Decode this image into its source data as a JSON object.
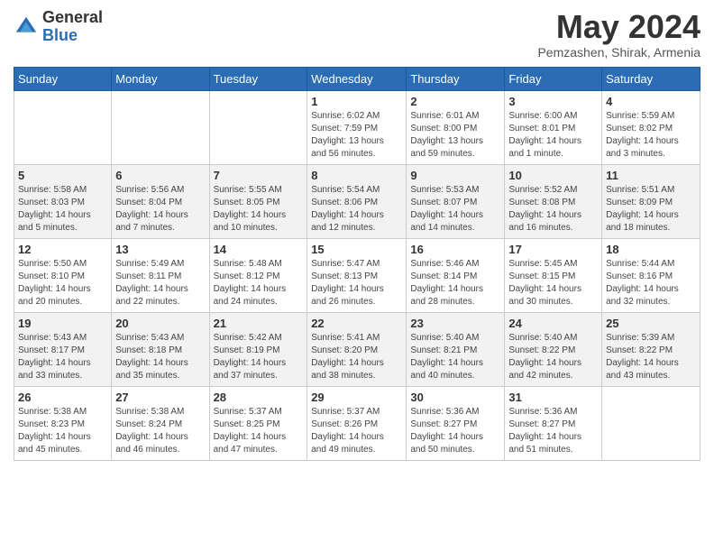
{
  "header": {
    "logo_general": "General",
    "logo_blue": "Blue",
    "month_title": "May 2024",
    "location": "Pemzashen, Shirak, Armenia"
  },
  "days_of_week": [
    "Sunday",
    "Monday",
    "Tuesday",
    "Wednesday",
    "Thursday",
    "Friday",
    "Saturday"
  ],
  "weeks": [
    [
      {
        "day": "",
        "info": ""
      },
      {
        "day": "",
        "info": ""
      },
      {
        "day": "",
        "info": ""
      },
      {
        "day": "1",
        "info": "Sunrise: 6:02 AM\nSunset: 7:59 PM\nDaylight: 13 hours\nand 56 minutes."
      },
      {
        "day": "2",
        "info": "Sunrise: 6:01 AM\nSunset: 8:00 PM\nDaylight: 13 hours\nand 59 minutes."
      },
      {
        "day": "3",
        "info": "Sunrise: 6:00 AM\nSunset: 8:01 PM\nDaylight: 14 hours\nand 1 minute."
      },
      {
        "day": "4",
        "info": "Sunrise: 5:59 AM\nSunset: 8:02 PM\nDaylight: 14 hours\nand 3 minutes."
      }
    ],
    [
      {
        "day": "5",
        "info": "Sunrise: 5:58 AM\nSunset: 8:03 PM\nDaylight: 14 hours\nand 5 minutes."
      },
      {
        "day": "6",
        "info": "Sunrise: 5:56 AM\nSunset: 8:04 PM\nDaylight: 14 hours\nand 7 minutes."
      },
      {
        "day": "7",
        "info": "Sunrise: 5:55 AM\nSunset: 8:05 PM\nDaylight: 14 hours\nand 10 minutes."
      },
      {
        "day": "8",
        "info": "Sunrise: 5:54 AM\nSunset: 8:06 PM\nDaylight: 14 hours\nand 12 minutes."
      },
      {
        "day": "9",
        "info": "Sunrise: 5:53 AM\nSunset: 8:07 PM\nDaylight: 14 hours\nand 14 minutes."
      },
      {
        "day": "10",
        "info": "Sunrise: 5:52 AM\nSunset: 8:08 PM\nDaylight: 14 hours\nand 16 minutes."
      },
      {
        "day": "11",
        "info": "Sunrise: 5:51 AM\nSunset: 8:09 PM\nDaylight: 14 hours\nand 18 minutes."
      }
    ],
    [
      {
        "day": "12",
        "info": "Sunrise: 5:50 AM\nSunset: 8:10 PM\nDaylight: 14 hours\nand 20 minutes."
      },
      {
        "day": "13",
        "info": "Sunrise: 5:49 AM\nSunset: 8:11 PM\nDaylight: 14 hours\nand 22 minutes."
      },
      {
        "day": "14",
        "info": "Sunrise: 5:48 AM\nSunset: 8:12 PM\nDaylight: 14 hours\nand 24 minutes."
      },
      {
        "day": "15",
        "info": "Sunrise: 5:47 AM\nSunset: 8:13 PM\nDaylight: 14 hours\nand 26 minutes."
      },
      {
        "day": "16",
        "info": "Sunrise: 5:46 AM\nSunset: 8:14 PM\nDaylight: 14 hours\nand 28 minutes."
      },
      {
        "day": "17",
        "info": "Sunrise: 5:45 AM\nSunset: 8:15 PM\nDaylight: 14 hours\nand 30 minutes."
      },
      {
        "day": "18",
        "info": "Sunrise: 5:44 AM\nSunset: 8:16 PM\nDaylight: 14 hours\nand 32 minutes."
      }
    ],
    [
      {
        "day": "19",
        "info": "Sunrise: 5:43 AM\nSunset: 8:17 PM\nDaylight: 14 hours\nand 33 minutes."
      },
      {
        "day": "20",
        "info": "Sunrise: 5:43 AM\nSunset: 8:18 PM\nDaylight: 14 hours\nand 35 minutes."
      },
      {
        "day": "21",
        "info": "Sunrise: 5:42 AM\nSunset: 8:19 PM\nDaylight: 14 hours\nand 37 minutes."
      },
      {
        "day": "22",
        "info": "Sunrise: 5:41 AM\nSunset: 8:20 PM\nDaylight: 14 hours\nand 38 minutes."
      },
      {
        "day": "23",
        "info": "Sunrise: 5:40 AM\nSunset: 8:21 PM\nDaylight: 14 hours\nand 40 minutes."
      },
      {
        "day": "24",
        "info": "Sunrise: 5:40 AM\nSunset: 8:22 PM\nDaylight: 14 hours\nand 42 minutes."
      },
      {
        "day": "25",
        "info": "Sunrise: 5:39 AM\nSunset: 8:22 PM\nDaylight: 14 hours\nand 43 minutes."
      }
    ],
    [
      {
        "day": "26",
        "info": "Sunrise: 5:38 AM\nSunset: 8:23 PM\nDaylight: 14 hours\nand 45 minutes."
      },
      {
        "day": "27",
        "info": "Sunrise: 5:38 AM\nSunset: 8:24 PM\nDaylight: 14 hours\nand 46 minutes."
      },
      {
        "day": "28",
        "info": "Sunrise: 5:37 AM\nSunset: 8:25 PM\nDaylight: 14 hours\nand 47 minutes."
      },
      {
        "day": "29",
        "info": "Sunrise: 5:37 AM\nSunset: 8:26 PM\nDaylight: 14 hours\nand 49 minutes."
      },
      {
        "day": "30",
        "info": "Sunrise: 5:36 AM\nSunset: 8:27 PM\nDaylight: 14 hours\nand 50 minutes."
      },
      {
        "day": "31",
        "info": "Sunrise: 5:36 AM\nSunset: 8:27 PM\nDaylight: 14 hours\nand 51 minutes."
      },
      {
        "day": "",
        "info": ""
      }
    ]
  ]
}
